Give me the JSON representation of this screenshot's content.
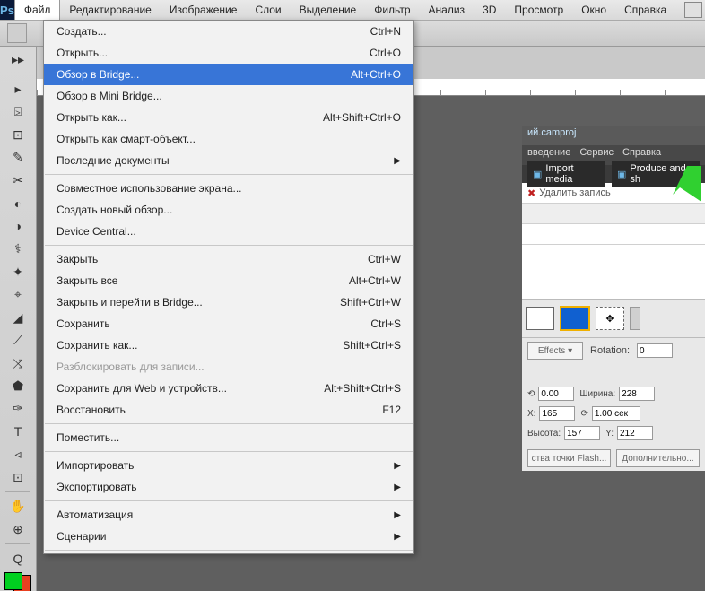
{
  "app": {
    "logo": "Ps"
  },
  "menubar": [
    "Файл",
    "Редактирование",
    "Изображение",
    "Слои",
    "Выделение",
    "Фильтр",
    "Анализ",
    "3D",
    "Просмотр",
    "Окно",
    "Справка"
  ],
  "dropdown": [
    {
      "label": "Создать...",
      "short": "Ctrl+N",
      "type": "item"
    },
    {
      "label": "Открыть...",
      "short": "Ctrl+O",
      "type": "item"
    },
    {
      "label": "Обзор в Bridge...",
      "short": "Alt+Ctrl+O",
      "type": "item",
      "hl": true
    },
    {
      "label": "Обзор в Mini Bridge...",
      "short": "",
      "type": "item"
    },
    {
      "label": "Открыть как...",
      "short": "Alt+Shift+Ctrl+O",
      "type": "item"
    },
    {
      "label": "Открыть как смарт-объект...",
      "short": "",
      "type": "item"
    },
    {
      "label": "Последние документы",
      "short": "",
      "type": "sub"
    },
    {
      "type": "sep"
    },
    {
      "label": "Совместное использование экрана...",
      "short": "",
      "type": "item"
    },
    {
      "label": "Создать новый обзор...",
      "short": "",
      "type": "item"
    },
    {
      "label": "Device Central...",
      "short": "",
      "type": "item"
    },
    {
      "type": "sep"
    },
    {
      "label": "Закрыть",
      "short": "Ctrl+W",
      "type": "item"
    },
    {
      "label": "Закрыть все",
      "short": "Alt+Ctrl+W",
      "type": "item"
    },
    {
      "label": "Закрыть и перейти в Bridge...",
      "short": "Shift+Ctrl+W",
      "type": "item"
    },
    {
      "label": "Сохранить",
      "short": "Ctrl+S",
      "type": "item"
    },
    {
      "label": "Сохранить как...",
      "short": "Shift+Ctrl+S",
      "type": "item"
    },
    {
      "label": "Разблокировать для записи...",
      "short": "",
      "type": "item",
      "disabled": true
    },
    {
      "label": "Сохранить для Web и устройств...",
      "short": "Alt+Shift+Ctrl+S",
      "type": "item"
    },
    {
      "label": "Восстановить",
      "short": "F12",
      "type": "item"
    },
    {
      "type": "sep"
    },
    {
      "label": "Поместить...",
      "short": "",
      "type": "item"
    },
    {
      "type": "sep"
    },
    {
      "label": "Импортировать",
      "short": "",
      "type": "sub"
    },
    {
      "label": "Экспортировать",
      "short": "",
      "type": "sub"
    },
    {
      "type": "sep"
    },
    {
      "label": "Автоматизация",
      "short": "",
      "type": "sub"
    },
    {
      "label": "Сценарии",
      "short": "",
      "type": "sub"
    },
    {
      "type": "sep"
    }
  ],
  "right": {
    "title": "ий.camproj",
    "menubar": [
      "введение",
      "Сервис",
      "Справка"
    ],
    "import": "Import media",
    "produce": "Produce and sh",
    "delete": "Удалить запись",
    "effects": "Effects ▾",
    "rotation_lbl": "Rotation:",
    "rotation_val": "0",
    "w_lbl": "Ширина:",
    "w_val": "228",
    "h_lbl": "Высота:",
    "h_val": "157",
    "x_lbl": "X:",
    "x_val": "165",
    "y_lbl": "Y:",
    "y_val": "212",
    "t1_lbl": "",
    "t1_val": "0.00",
    "t2_lbl": "",
    "t2_val": "1.00 сек",
    "flash_btn": "ства точки Flash...",
    "more_btn": "Дополнительно..."
  },
  "colors": {
    "fg": "#00d020",
    "bg": "#e84020"
  }
}
